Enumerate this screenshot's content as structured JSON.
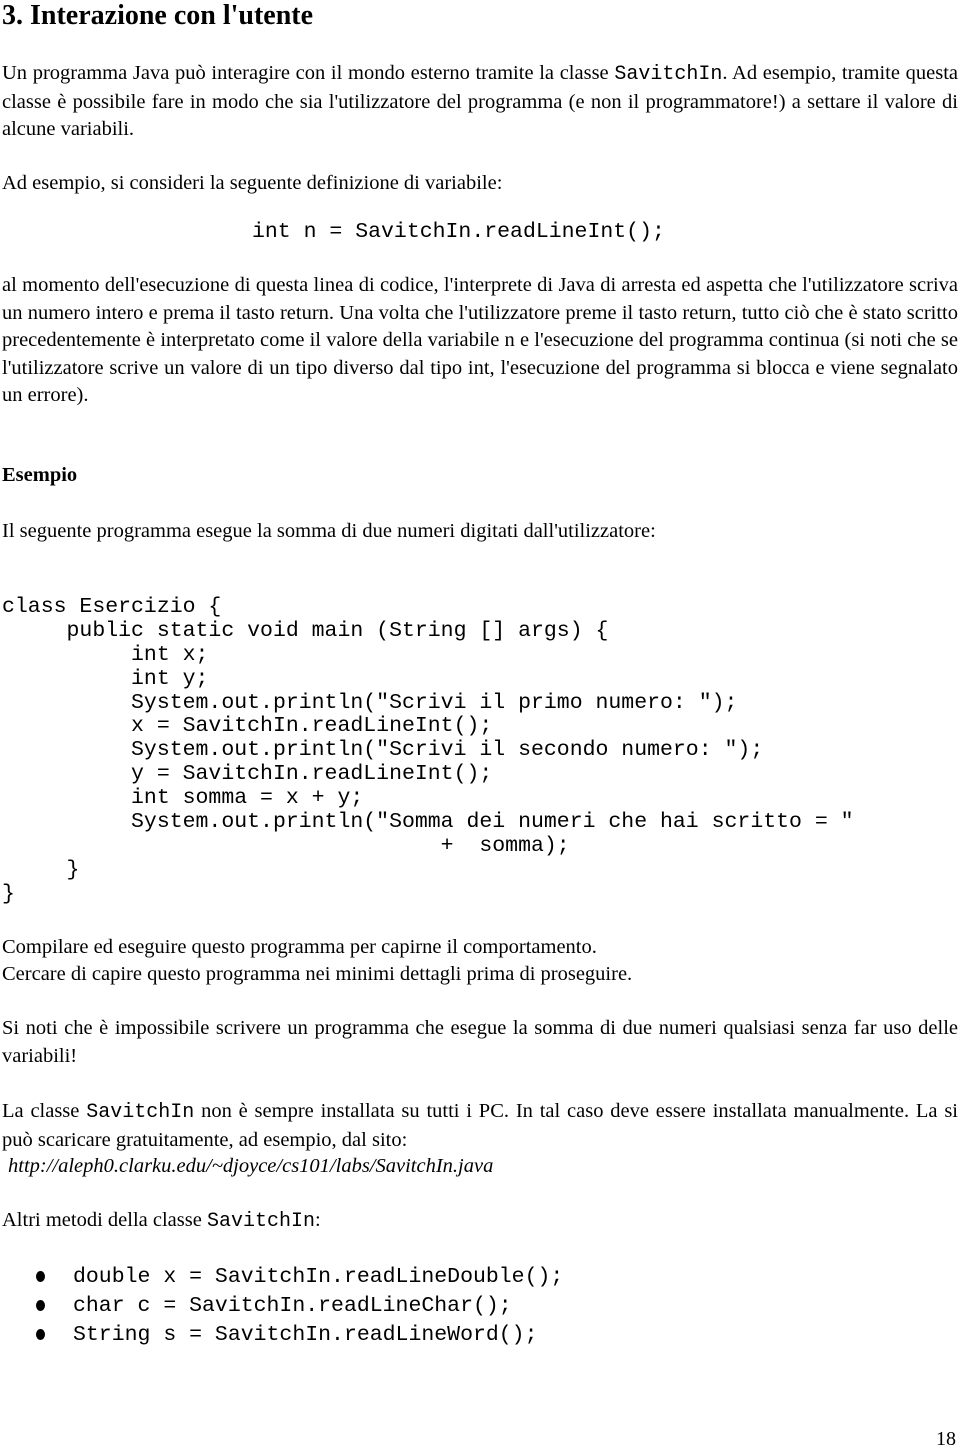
{
  "section_title": "3. Interazione con l'utente",
  "intro": {
    "part1": "Un programma Java può interagire con il mondo esterno tramite la classe ",
    "class_name": "SavitchIn",
    "part2": ". Ad esempio, tramite questa classe è possibile fare in modo che sia l'utilizzatore del programma (e non il programmatore!) a settare il valore di alcune variabili."
  },
  "example_intro": "Ad esempio, si consideri la seguente definizione di variabile:",
  "example_code": "int n = SavitchIn.readLineInt();",
  "explanation": "al momento dell'esecuzione di questa linea di codice, l'interprete di Java di arresta ed aspetta che l'utilizzatore scriva un numero intero e prema il tasto return. Una volta che l'utilizzatore preme il tasto return, tutto ciò che è stato scritto precedentemente è interpretato come il valore della variabile n e l'esecuzione del programma continua (si noti che se l'utilizzatore scrive un valore di un tipo diverso dal tipo int, l'esecuzione del programma si blocca e viene segnalato un errore).",
  "esempio_heading": "Esempio",
  "program_intro": "Il seguente programma esegue la somma di due numeri digitati dall'utilizzatore:",
  "program_lines": [
    "class Esercizio {",
    "     public static void main (String [] args) {",
    "          int x;",
    "          int y;",
    "          System.out.println(\"Scrivi il primo numero: \");",
    "          x = SavitchIn.readLineInt();",
    "          System.out.println(\"Scrivi il secondo numero: \");",
    "          y = SavitchIn.readLineInt();",
    "          int somma = x + y;",
    "          System.out.println(\"Somma dei numeri che hai scritto = \"",
    "                                  +  somma);",
    "     }",
    "}"
  ],
  "compile_line1": "Compilare ed eseguire questo programma per capirne il comportamento.",
  "compile_line2": "Cercare di capire questo programma nei minimi dettagli prima di proseguire.",
  "note": "Si noti che è impossibile scrivere un programma che esegue la somma di due numeri qualsiasi senza far uso delle variabili!",
  "install": {
    "part1": "La classe ",
    "class_name": "SavitchIn",
    "part2": " non è sempre installata su tutti i PC. In tal caso deve essere installata manualmente. La si può scaricare gratuitamente, ad esempio, dal sito:",
    "url": "http://aleph0.clarku.edu/~djoyce/cs101/labs/SavitchIn.java"
  },
  "other_methods": {
    "label": "Altri metodi della classe ",
    "class_name": "SavitchIn",
    "suffix": ":",
    "items": [
      "double x = SavitchIn.readLineDouble();",
      "char c = SavitchIn.readLineChar();",
      "String s = SavitchIn.readLineWord();"
    ]
  },
  "page_number": "18"
}
